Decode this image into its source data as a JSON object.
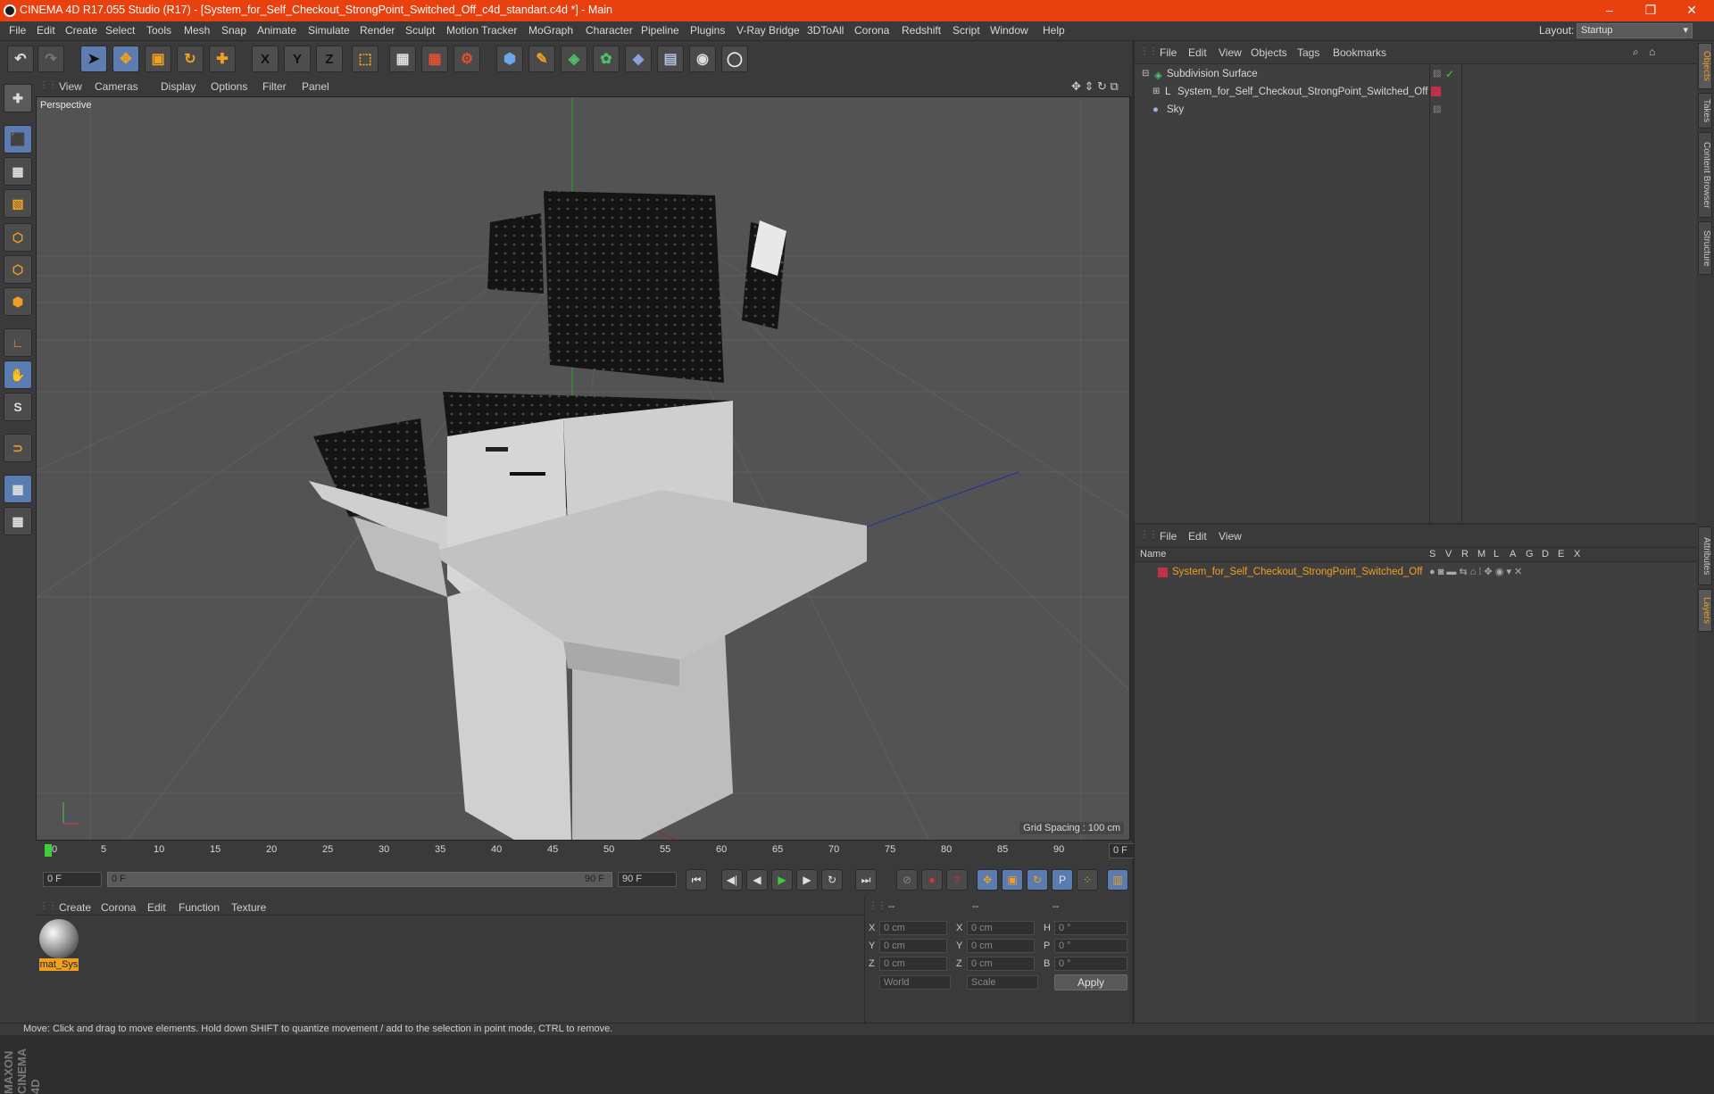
{
  "title_bar": {
    "title": "CINEMA 4D R17.055 Studio (R17) - [System_for_Self_Checkout_StrongPoint_Switched_Off_c4d_standart.c4d *] - Main",
    "minimize": "–",
    "restore": "❐",
    "close": "✕"
  },
  "menu": [
    "File",
    "Edit",
    "Create",
    "Select",
    "Tools",
    "Mesh",
    "Snap",
    "Animate",
    "Simulate",
    "Render",
    "Sculpt",
    "Motion Tracker",
    "MoGraph",
    "Character",
    "Pipeline",
    "Plugins",
    "V-Ray Bridge",
    "3DToAll",
    "Corona",
    "Redshift",
    "Script",
    "Window",
    "Help"
  ],
  "layout": {
    "label": "Layout:",
    "value": "Startup"
  },
  "toolbar_icons": [
    "undo-icon",
    "redo-icon",
    "select-arrow-icon",
    "move-icon",
    "scale-icon",
    "rotate-icon",
    "move-plus-icon",
    "x-axis-icon",
    "y-axis-icon",
    "z-axis-icon",
    "coord-system-icon",
    "render-view-icon",
    "render-picture-viewer-icon",
    "render-settings-icon",
    "cube-icon",
    "pen-icon",
    "subdivision-icon",
    "cloner-icon",
    "deformer-icon",
    "floor-icon",
    "camera-icon",
    "light-icon"
  ],
  "axis_labels": [
    "X",
    "Y",
    "Z"
  ],
  "viewport": {
    "menu": [
      "View",
      "Cameras",
      "Display",
      "Options",
      "Filter",
      "Panel"
    ],
    "label": "Perspective",
    "grid_spacing": "Grid Spacing : 100 cm"
  },
  "timeline": {
    "ticks": [
      "0",
      "5",
      "10",
      "15",
      "20",
      "25",
      "30",
      "35",
      "40",
      "45",
      "50",
      "55",
      "60",
      "65",
      "70",
      "75",
      "80",
      "85",
      "90"
    ],
    "current_frame": "0 F"
  },
  "playback": {
    "start": "0 F",
    "range_start": "0 F",
    "range_end": "90 F",
    "end": "90 F"
  },
  "material_panel": {
    "menu": [
      "Create",
      "Corona",
      "Edit",
      "Function",
      "Texture"
    ],
    "material_name": "mat_Sys"
  },
  "coordinates": {
    "headers": [
      "--",
      "--",
      "--"
    ],
    "rows": [
      {
        "a": "X",
        "av": "0 cm",
        "b": "X",
        "bv": "0 cm",
        "c": "H",
        "cv": "0 °"
      },
      {
        "a": "Y",
        "av": "0 cm",
        "b": "Y",
        "bv": "0 cm",
        "c": "P",
        "cv": "0 °"
      },
      {
        "a": "Z",
        "av": "0 cm",
        "b": "Z",
        "bv": "0 cm",
        "c": "B",
        "cv": "0 °"
      }
    ],
    "mode": "World",
    "scale": "Scale",
    "apply": "Apply"
  },
  "object_manager": {
    "menu": [
      "File",
      "Edit",
      "View",
      "Objects",
      "Tags",
      "Bookmarks"
    ],
    "objects": [
      {
        "name": "Subdivision Surface"
      },
      {
        "name": "System_for_Self_Checkout_StrongPoint_Switched_Off"
      },
      {
        "name": "Sky"
      }
    ]
  },
  "layer_manager": {
    "menu": [
      "File",
      "Edit",
      "View"
    ],
    "columns": [
      "Name",
      "S",
      "V",
      "R",
      "M",
      "L",
      "A",
      "G",
      "D",
      "E",
      "X"
    ],
    "layers": [
      {
        "name": "System_for_Self_Checkout_StrongPoint_Switched_Off"
      }
    ]
  },
  "right_tabs": [
    "Objects",
    "Takes",
    "Content Browser",
    "Structure",
    "Attributes",
    "Layers"
  ],
  "logo": "MAXON CINEMA 4D",
  "status": "Move: Click and drag to move elements. Hold down SHIFT to quantize movement / add to the selection in point mode, CTRL to remove.",
  "colors": {
    "title_bar": "#e8400f",
    "accent_orange": "#f0a020",
    "selection_blue": "#5a7cb0"
  }
}
